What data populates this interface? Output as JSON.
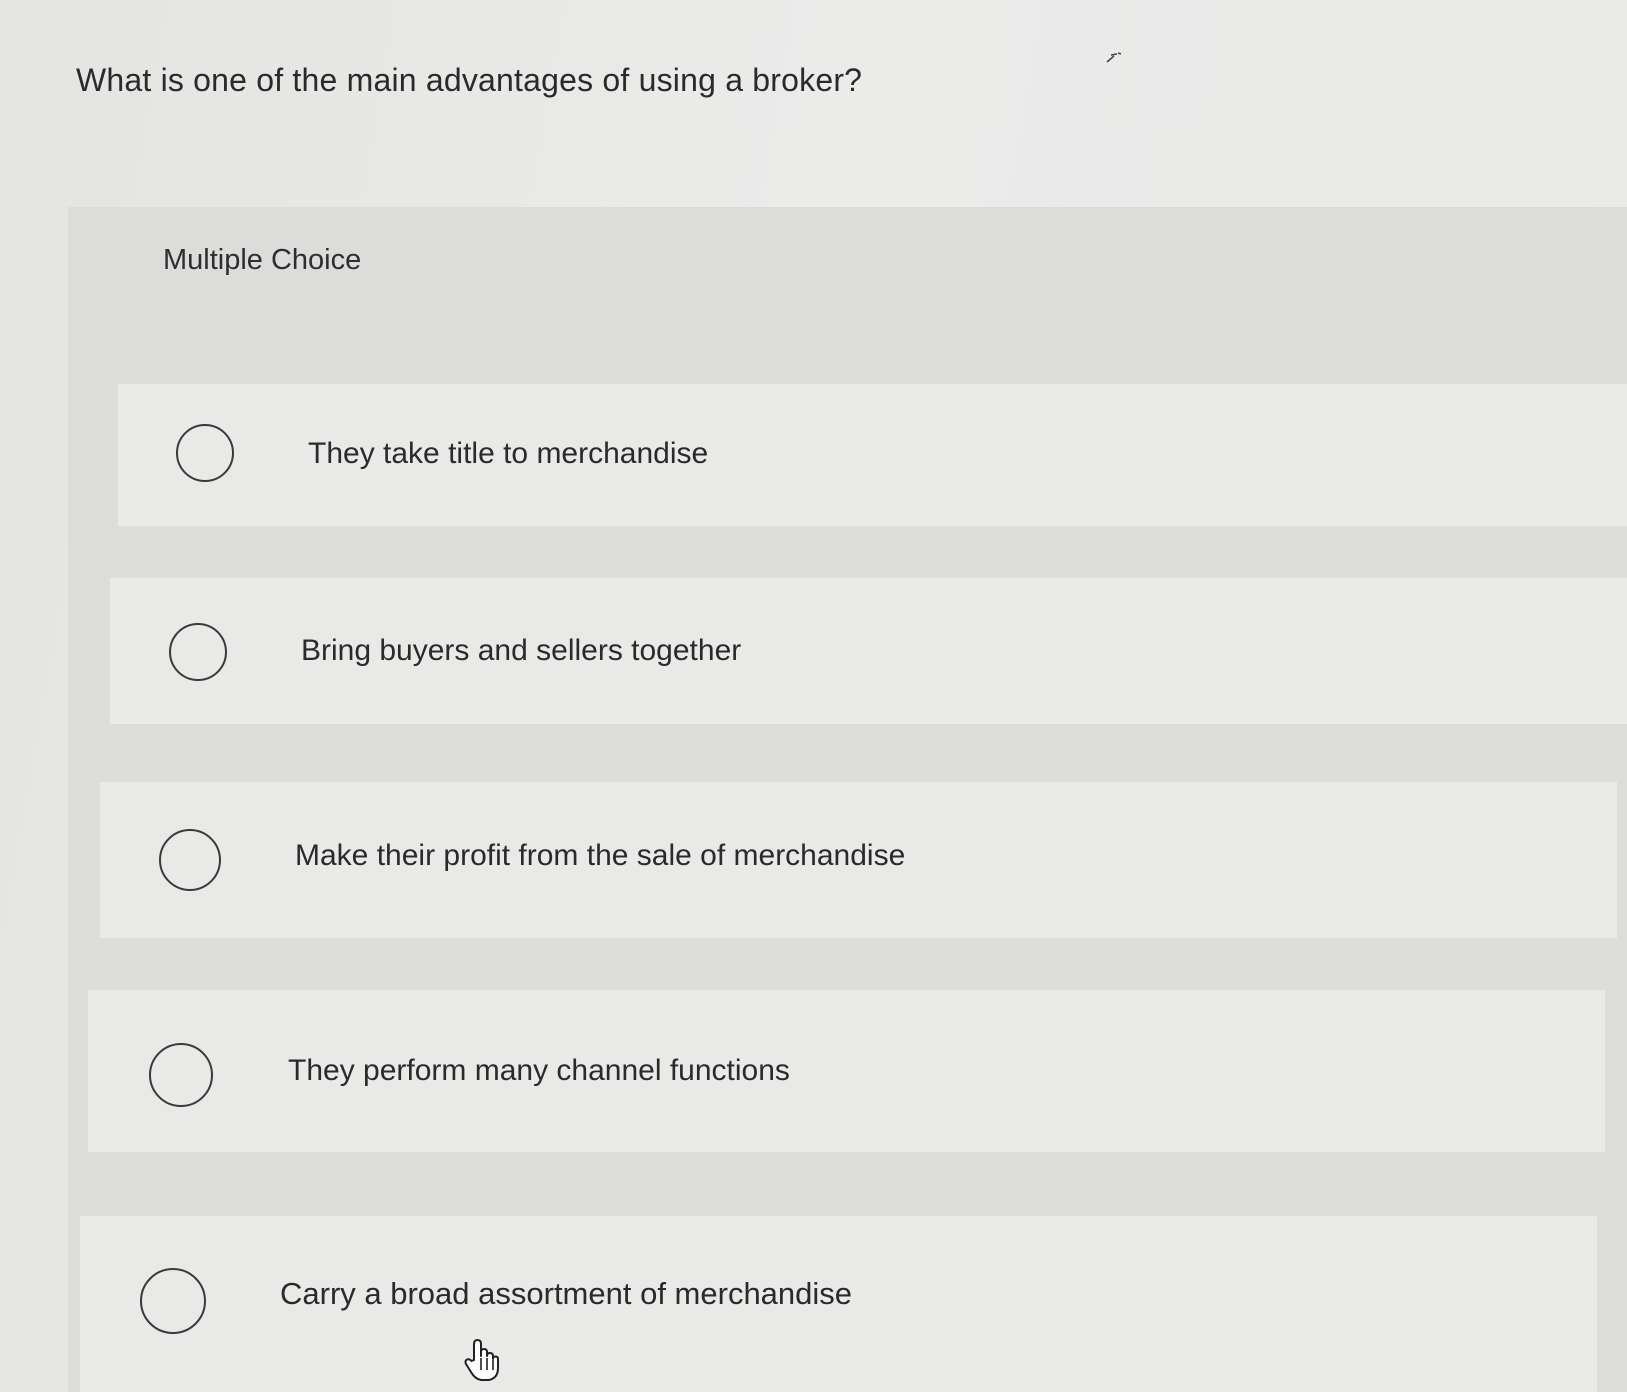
{
  "question": {
    "text": "What is one of the main advantages of using a broker?"
  },
  "panel": {
    "title": "Multiple Choice"
  },
  "options": [
    {
      "label": "They take title to merchandise",
      "selected": false
    },
    {
      "label": "Bring buyers and sellers together",
      "selected": false
    },
    {
      "label": "Make their profit from the sale of merchandise",
      "selected": false
    },
    {
      "label": "They perform many channel functions",
      "selected": false
    },
    {
      "label": "Carry a broad assortment of merchandise",
      "selected": false
    }
  ],
  "cursor": {
    "icon": "hand-pointer-icon"
  }
}
